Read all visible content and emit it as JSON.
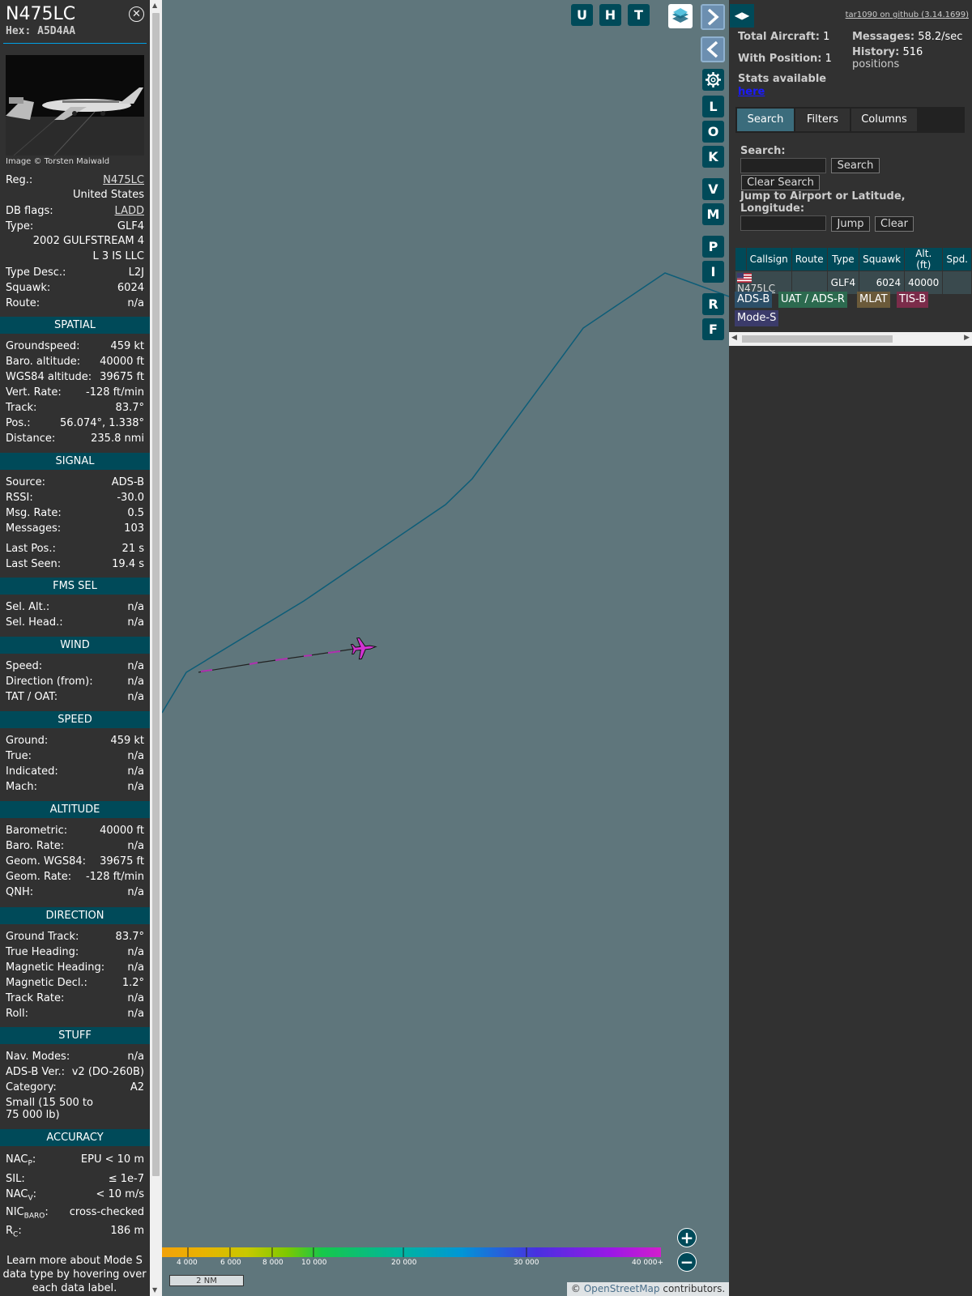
{
  "aircraft": {
    "registration": "N475LC",
    "hex": "Hex: A5D4AA",
    "photo_credit": "Image © Torsten Maiwald"
  },
  "info": {
    "reg_label": "Reg.:",
    "reg_value": "N475LC",
    "country": "United States",
    "dbflags_label": "DB flags:",
    "dbflags_value": "LADD",
    "type_label": "Type:",
    "type_value": "GLF4",
    "model": "2002 GULFSTREAM 4",
    "owner": "L 3 IS LLC",
    "typedesc_label": "Type Desc.:",
    "typedesc_value": "L2J",
    "squawk_label": "Squawk:",
    "squawk_value": "6024",
    "route_label": "Route:",
    "route_value": "n/a"
  },
  "sections": {
    "spatial": {
      "title": "SPATIAL",
      "rows": [
        {
          "label": "Groundspeed:",
          "value": "459 kt"
        },
        {
          "label": "Baro. altitude:",
          "value": "40000 ft"
        },
        {
          "label": "WGS84 altitude:",
          "value": "39675 ft"
        },
        {
          "label": "Vert. Rate:",
          "value": "-128 ft/min"
        },
        {
          "label": "Track:",
          "value": "83.7°"
        },
        {
          "label": "Pos.:",
          "value": "56.074°, 1.338°"
        },
        {
          "label": "Distance:",
          "value": "235.8 nmi"
        }
      ]
    },
    "signal": {
      "title": "SIGNAL",
      "rows": [
        {
          "label": "Source:",
          "value": "ADS-B"
        },
        {
          "label": "RSSI:",
          "value": "-30.0"
        },
        {
          "label": "Msg. Rate:",
          "value": "0.5"
        },
        {
          "label": "Messages:",
          "value": "103"
        },
        {
          "label": "Last Pos.:",
          "value": "21 s"
        },
        {
          "label": "Last Seen:",
          "value": "19.4 s"
        }
      ]
    },
    "fms": {
      "title": "FMS SEL",
      "rows": [
        {
          "label": "Sel. Alt.:",
          "value": "n/a"
        },
        {
          "label": "Sel. Head.:",
          "value": "n/a"
        }
      ]
    },
    "wind": {
      "title": "WIND",
      "rows": [
        {
          "label": "Speed:",
          "value": "n/a"
        },
        {
          "label": "Direction (from):",
          "value": "n/a"
        },
        {
          "label": "TAT / OAT:",
          "value": "n/a"
        }
      ]
    },
    "speed": {
      "title": "SPEED",
      "rows": [
        {
          "label": "Ground:",
          "value": "459 kt"
        },
        {
          "label": "True:",
          "value": "n/a"
        },
        {
          "label": "Indicated:",
          "value": "n/a"
        },
        {
          "label": "Mach:",
          "value": "n/a"
        }
      ]
    },
    "altitude": {
      "title": "ALTITUDE",
      "rows": [
        {
          "label": "Barometric:",
          "value": "40000 ft"
        },
        {
          "label": "Baro. Rate:",
          "value": "n/a"
        },
        {
          "label": "Geom. WGS84:",
          "value": "39675 ft"
        },
        {
          "label": "Geom. Rate:",
          "value": "-128 ft/min"
        },
        {
          "label": "QNH:",
          "value": "n/a"
        }
      ]
    },
    "direction": {
      "title": "DIRECTION",
      "rows": [
        {
          "label": "Ground Track:",
          "value": "83.7°"
        },
        {
          "label": "True Heading:",
          "value": "n/a"
        },
        {
          "label": "Magnetic Heading:",
          "value": "n/a"
        },
        {
          "label": "Magnetic Decl.:",
          "value": "1.2°"
        },
        {
          "label": "Track Rate:",
          "value": "n/a"
        },
        {
          "label": "Roll:",
          "value": "n/a"
        }
      ]
    },
    "stuff": {
      "title": "STUFF",
      "rows": [
        {
          "label": "Nav. Modes:",
          "value": "n/a"
        },
        {
          "label": "ADS-B Ver.:",
          "value": "v2 (DO-260B)"
        },
        {
          "label": "Category:",
          "value": "A2"
        }
      ],
      "category_desc": "Small (15 500 to 75 000 lb)"
    },
    "accuracy": {
      "title": "ACCURACY",
      "rows": [
        {
          "label": "NACP:",
          "label_main": "NAC",
          "label_sub": "P",
          "value": "EPU < 10 m"
        },
        {
          "label": "SIL:",
          "value": "≤ 1e-7"
        },
        {
          "label": "NACV:",
          "label_main": "NAC",
          "label_sub": "V",
          "value": "< 10 m/s"
        },
        {
          "label": "NICBARO:",
          "label_main": "NIC",
          "label_sub": "BARO",
          "value": "cross-checked"
        },
        {
          "label": "RC:",
          "label_main": "R",
          "label_sub": "C",
          "value": "186 m"
        }
      ]
    },
    "note": "Learn more about Mode S data type by hovering over each data label."
  },
  "map": {
    "top_buttons": [
      "U",
      "H",
      "T"
    ],
    "side_buttons": [
      "L",
      "O",
      "K",
      "V",
      "M",
      "P",
      "I",
      "R",
      "F"
    ],
    "altitude_legend": [
      "4 000",
      "6 000",
      "8 000",
      "10 000",
      "20 000",
      "30 000",
      "40 000+"
    ],
    "scale": "2 NM",
    "attribution_prefix": "© ",
    "attribution_link": "OpenStreetMap",
    "attribution_suffix": " contributors.",
    "track_color": "#0d5d78",
    "aircraft_color": "#d233d2"
  },
  "sidebar": {
    "github": "tar1090 on github (3.14.1699)",
    "total_label": "Total Aircraft:",
    "total_value": "1",
    "withpos_label": "With Position:",
    "withpos_value": "1",
    "stats_text": "Stats available",
    "stats_link": "here",
    "messages_label": "Messages:",
    "messages_value": "58.2/sec",
    "history_label": "History:",
    "history_value": "516",
    "history_unit": "positions",
    "tabs": [
      "Search",
      "Filters",
      "Columns"
    ],
    "search_label": "Search:",
    "search_button": "Search",
    "clear_search_button": "Clear Search",
    "jump_label": "Jump to Airport or Latitude, Longitude:",
    "jump_button": "Jump",
    "clear_button": "Clear",
    "table": {
      "headers": [
        "",
        "Callsign",
        "Route",
        "Type",
        "Squawk",
        "Alt. (ft)",
        "Spd."
      ],
      "row": {
        "callsign": "N475LC",
        "route": "",
        "type": "GLF4",
        "squawk": "6024",
        "alt": "40000",
        "spd": ""
      }
    },
    "badges": [
      {
        "label": "ADS-B",
        "color": "#2c4f68"
      },
      {
        "label": "UAT / ADS-R",
        "color": "#2c6a4f"
      },
      {
        "label": "MLAT",
        "color": "#6b5a3a"
      },
      {
        "label": "TIS-B",
        "color": "#7b2c4a"
      },
      {
        "label": "Mode-S",
        "color": "#3b3b6a"
      }
    ]
  }
}
